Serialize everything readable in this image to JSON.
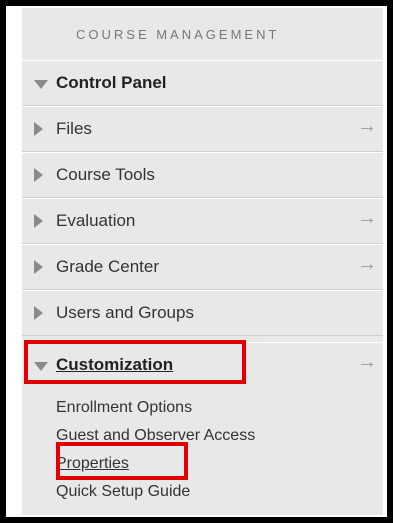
{
  "section_title": "COURSE MANAGEMENT",
  "control_panel": {
    "label": "Control Panel"
  },
  "menu": [
    {
      "label": "Files",
      "arrow": "→"
    },
    {
      "label": "Course Tools",
      "arrow": ""
    },
    {
      "label": "Evaluation",
      "arrow": "→"
    },
    {
      "label": "Grade Center",
      "arrow": "→"
    },
    {
      "label": "Users and Groups",
      "arrow": ""
    }
  ],
  "customization": {
    "label": "Customization",
    "arrow": "→",
    "items": [
      {
        "label": "Enrollment Options"
      },
      {
        "label": "Guest and Observer Access"
      },
      {
        "label": "Properties"
      },
      {
        "label": "Quick Setup Guide"
      }
    ]
  },
  "highlight_color": "#e00000"
}
